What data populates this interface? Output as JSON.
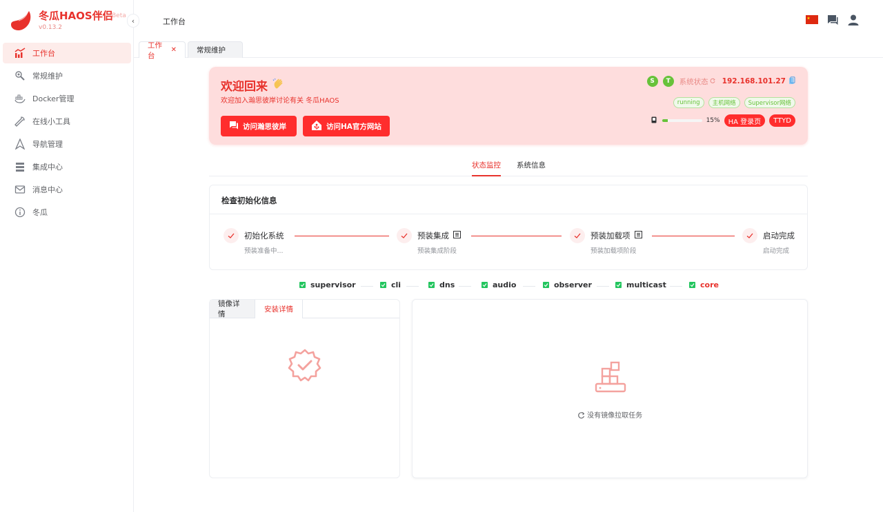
{
  "brand": {
    "title": "冬瓜HAOS伴侣",
    "badge": "Beta",
    "version": "v0.13.2",
    "color": "#e8322c"
  },
  "sidebar": {
    "items": [
      {
        "label": "工作台",
        "icon": "chart-line-icon",
        "active": true
      },
      {
        "label": "常规维护",
        "icon": "wrench-gear-icon",
        "active": false
      },
      {
        "label": "Docker管理",
        "icon": "docker-icon",
        "active": false
      },
      {
        "label": "在线小工具",
        "icon": "wrench-icon",
        "active": false
      },
      {
        "label": "导航管理",
        "icon": "navigation-icon",
        "active": false
      },
      {
        "label": "集成中心",
        "icon": "integration-icon",
        "active": false
      },
      {
        "label": "消息中心",
        "icon": "mail-icon",
        "active": false
      },
      {
        "label": "冬瓜",
        "icon": "info-icon",
        "active": false
      }
    ]
  },
  "header": {
    "title": "工作台"
  },
  "tabs": [
    {
      "label": "工作台",
      "active": true,
      "closable": true,
      "close_glyph": "✕"
    },
    {
      "label": "常规维护",
      "active": false
    }
  ],
  "banner": {
    "title": "欢迎回来",
    "subtitle": "欢迎加入瀚思彼岸讨论有关 冬瓜HAOS",
    "buttons": [
      {
        "label": "访问瀚思彼岸"
      },
      {
        "label": "访问HA官方网站"
      }
    ],
    "status_badges": [
      "S",
      "T"
    ],
    "status_label": "系统状态",
    "ip": "192.168.101.27",
    "tags": [
      "running",
      "主机网络",
      "Supervisor网络"
    ],
    "disk_usage_percent": 15,
    "disk_usage_text": "15%",
    "pills": [
      "HA 登录页",
      "TTYD"
    ]
  },
  "section_tabs": [
    "状态监控",
    "系统信息"
  ],
  "init": {
    "title": "检查初始化信息",
    "steps": [
      {
        "title": "初始化系统",
        "desc": "预装准备中..."
      },
      {
        "title": "预装集成",
        "desc": "预装集成阶段"
      },
      {
        "title": "预装加载项",
        "desc": "预装加载项阶段"
      },
      {
        "title": "启动完成",
        "desc": "启动完成"
      }
    ]
  },
  "components": [
    "supervisor",
    "cli",
    "dns",
    "audio",
    "observer",
    "multicast",
    "core"
  ],
  "left_panel": {
    "tabs": [
      "镜像详情",
      "安装详情"
    ]
  },
  "right_panel": {
    "empty_text": "没有镜像拉取任务"
  }
}
